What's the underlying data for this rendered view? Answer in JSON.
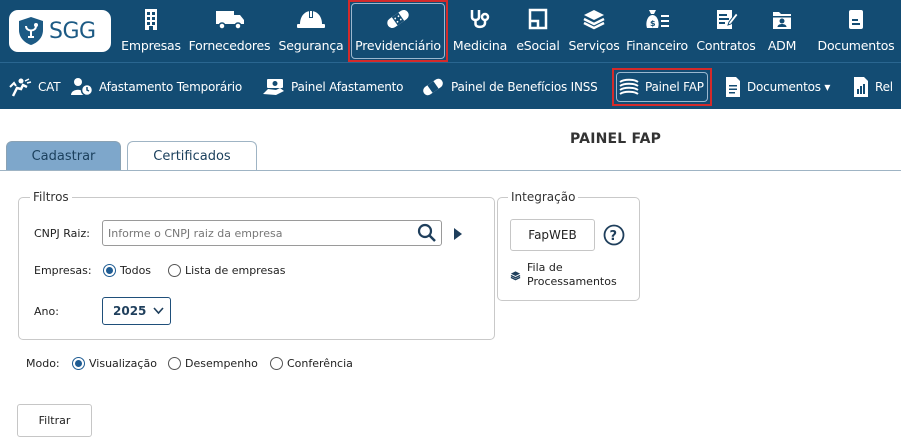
{
  "topnav": {
    "logo_text": "SGG",
    "items": [
      {
        "label": "Empresas",
        "icon": "building-icon"
      },
      {
        "label": "Fornecedores",
        "icon": "truck-icon"
      },
      {
        "label": "Segurança",
        "icon": "hardhat-icon"
      },
      {
        "label": "Previdenciário",
        "icon": "bandage-icon"
      },
      {
        "label": "Medicina",
        "icon": "stethoscope-icon"
      },
      {
        "label": "eSocial",
        "icon": "document-outline-icon"
      },
      {
        "label": "Serviços",
        "icon": "layers-icon"
      },
      {
        "label": "Financeiro",
        "icon": "money-bag-icon"
      },
      {
        "label": "Contratos",
        "icon": "contract-edit-icon"
      },
      {
        "label": "ADM",
        "icon": "folder-user-icon"
      },
      {
        "label": "Documentos",
        "icon": "file-icon"
      }
    ]
  },
  "subnav": {
    "items": [
      {
        "label": "CAT",
        "icon": "accident-icon"
      },
      {
        "label": "Afastamento Temporário",
        "icon": "person-clock-icon"
      },
      {
        "label": "Painel Afastamento",
        "icon": "money-hand-icon"
      },
      {
        "label": "Painel de Benefícios INSS",
        "icon": "bandage-icon"
      },
      {
        "label": "Painel FAP",
        "icon": "stack-icon"
      },
      {
        "label": "Documentos ▾",
        "icon": "file-text-icon"
      },
      {
        "label": "Rel",
        "icon": "report-chart-icon"
      }
    ]
  },
  "page": {
    "title": "PAINEL FAP"
  },
  "tabs": {
    "cadastrar": "Cadastrar",
    "certificados": "Certificados"
  },
  "filtros": {
    "legend": "Filtros",
    "cnpj_label": "CNPJ Raiz:",
    "cnpj_placeholder": "Informe o CNPJ raiz da empresa",
    "empresas_label": "Empresas:",
    "empresas_opt1": "Todos",
    "empresas_opt2": "Lista de empresas",
    "ano_label": "Ano:",
    "ano_value": "2025"
  },
  "integracao": {
    "legend": "Integração",
    "fapweb": "FapWEB",
    "fila_line1": "Fila de",
    "fila_line2": "Processamentos"
  },
  "modo": {
    "label": "Modo:",
    "opt1": "Visualização",
    "opt2": "Desempenho",
    "opt3": "Conferência"
  },
  "actions": {
    "filtrar": "Filtrar"
  },
  "colors": {
    "nav_bg": "#134c73",
    "highlight": "#d42a2a",
    "tab_selected": "#7ea7cb",
    "radio": "#1f5c93"
  }
}
